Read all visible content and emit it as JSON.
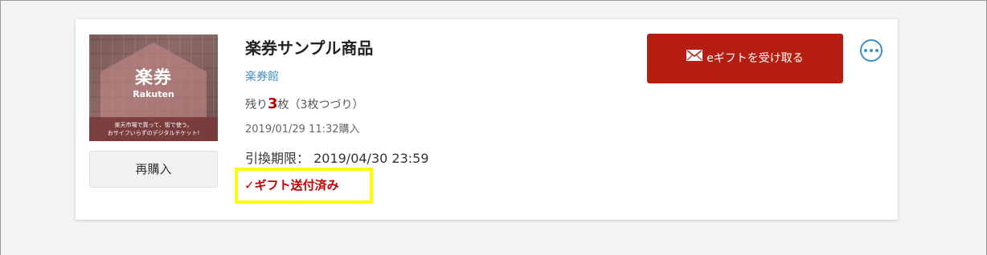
{
  "product": {
    "title": "楽券サンプル商品",
    "shop": "楽券館",
    "remaining_prefix": "残り",
    "remaining_count": "3",
    "remaining_suffix": "枚（3枚つづり）",
    "purchased": "2019/01/29 11:32購入",
    "expiry": "引換期限： 2019/04/30 23:59",
    "gift_status": "✓ギフト送付済み"
  },
  "thumbnail": {
    "logo_main": "楽券",
    "logo_sub": "Rakuten",
    "caption_line1": "楽天市場で買って、街で使う。",
    "caption_line2": "おサイフいらずのデジタルチケット!"
  },
  "actions": {
    "rebuy_label": "再購入",
    "receive_label": "eギフトを受け取る",
    "more_icon": "more-horizontal-icon",
    "mail_icon": "envelope-icon"
  },
  "colors": {
    "accent_red": "#bf0000",
    "button_red": "#b51e10",
    "link_blue": "#3f8fc7",
    "highlight_yellow": "#ffff00"
  }
}
